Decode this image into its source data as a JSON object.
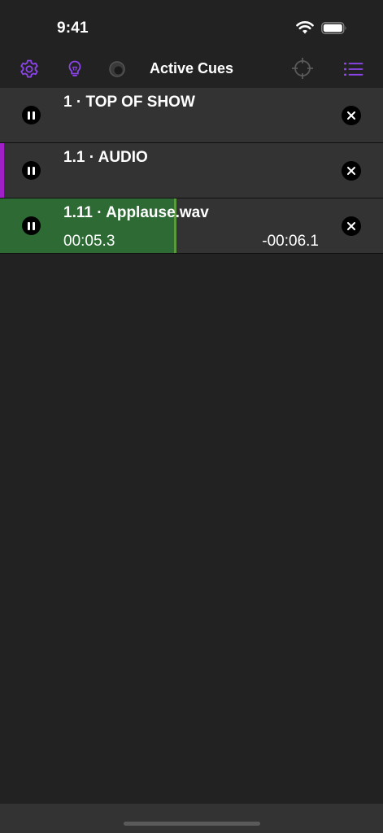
{
  "status_bar": {
    "time": "9:41"
  },
  "toolbar": {
    "title": "Active Cues",
    "accent_color": "#8e44ec",
    "icons": [
      "gear-icon",
      "lightbulb-icon",
      "circle-icon",
      "crosshair-icon",
      "list-icon"
    ]
  },
  "cues": [
    {
      "title": "1 · TOP OF SHOW",
      "elapsed": "",
      "remaining": "",
      "color": "",
      "progress": 0
    },
    {
      "title": "1.1 · AUDIO",
      "elapsed": "",
      "remaining": "",
      "color": "#a020c8",
      "progress": 0
    },
    {
      "title": "1.11 · Applause.wav",
      "elapsed": "00:05.3",
      "remaining": "-00:06.1",
      "color": "",
      "progress": 0.46
    }
  ],
  "colors": {
    "background": "#222222",
    "row_background": "#333333",
    "progress_fill": "#2d6a34",
    "progress_edge": "#5a9a3e"
  }
}
